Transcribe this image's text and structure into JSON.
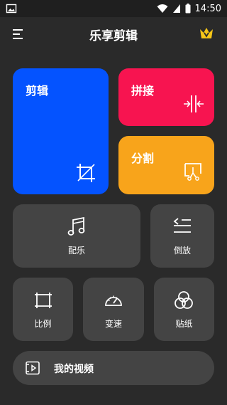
{
  "status": {
    "time": "14:50"
  },
  "header": {
    "title": "乐享剪辑"
  },
  "cards": {
    "edit": "剪辑",
    "join": "拼接",
    "split": "分割"
  },
  "tools": {
    "music": "配乐",
    "reverse": "倒放",
    "ratio": "比例",
    "speed": "变速",
    "sticker": "贴纸"
  },
  "my_video": {
    "label": "我的视频"
  },
  "colors": {
    "edit": "#0453ff",
    "join": "#f71450",
    "split": "#f8a41b",
    "tile": "#444444",
    "background": "#2a2a2a",
    "crown": "#f5c518"
  }
}
